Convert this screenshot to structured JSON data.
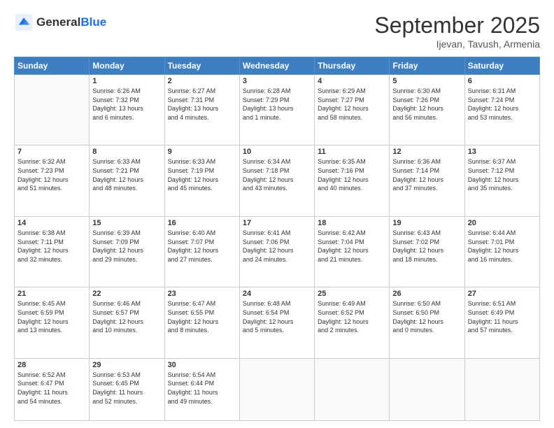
{
  "header": {
    "logo_line1": "General",
    "logo_line2": "Blue",
    "month_title": "September 2025",
    "location": "Ijevan, Tavush, Armenia"
  },
  "weekdays": [
    "Sunday",
    "Monday",
    "Tuesday",
    "Wednesday",
    "Thursday",
    "Friday",
    "Saturday"
  ],
  "weeks": [
    [
      {
        "day": "",
        "info": ""
      },
      {
        "day": "1",
        "info": "Sunrise: 6:26 AM\nSunset: 7:32 PM\nDaylight: 13 hours\nand 6 minutes."
      },
      {
        "day": "2",
        "info": "Sunrise: 6:27 AM\nSunset: 7:31 PM\nDaylight: 13 hours\nand 4 minutes."
      },
      {
        "day": "3",
        "info": "Sunrise: 6:28 AM\nSunset: 7:29 PM\nDaylight: 13 hours\nand 1 minute."
      },
      {
        "day": "4",
        "info": "Sunrise: 6:29 AM\nSunset: 7:27 PM\nDaylight: 12 hours\nand 58 minutes."
      },
      {
        "day": "5",
        "info": "Sunrise: 6:30 AM\nSunset: 7:26 PM\nDaylight: 12 hours\nand 56 minutes."
      },
      {
        "day": "6",
        "info": "Sunrise: 6:31 AM\nSunset: 7:24 PM\nDaylight: 12 hours\nand 53 minutes."
      }
    ],
    [
      {
        "day": "7",
        "info": "Sunrise: 6:32 AM\nSunset: 7:23 PM\nDaylight: 12 hours\nand 51 minutes."
      },
      {
        "day": "8",
        "info": "Sunrise: 6:33 AM\nSunset: 7:21 PM\nDaylight: 12 hours\nand 48 minutes."
      },
      {
        "day": "9",
        "info": "Sunrise: 6:33 AM\nSunset: 7:19 PM\nDaylight: 12 hours\nand 45 minutes."
      },
      {
        "day": "10",
        "info": "Sunrise: 6:34 AM\nSunset: 7:18 PM\nDaylight: 12 hours\nand 43 minutes."
      },
      {
        "day": "11",
        "info": "Sunrise: 6:35 AM\nSunset: 7:16 PM\nDaylight: 12 hours\nand 40 minutes."
      },
      {
        "day": "12",
        "info": "Sunrise: 6:36 AM\nSunset: 7:14 PM\nDaylight: 12 hours\nand 37 minutes."
      },
      {
        "day": "13",
        "info": "Sunrise: 6:37 AM\nSunset: 7:12 PM\nDaylight: 12 hours\nand 35 minutes."
      }
    ],
    [
      {
        "day": "14",
        "info": "Sunrise: 6:38 AM\nSunset: 7:11 PM\nDaylight: 12 hours\nand 32 minutes."
      },
      {
        "day": "15",
        "info": "Sunrise: 6:39 AM\nSunset: 7:09 PM\nDaylight: 12 hours\nand 29 minutes."
      },
      {
        "day": "16",
        "info": "Sunrise: 6:40 AM\nSunset: 7:07 PM\nDaylight: 12 hours\nand 27 minutes."
      },
      {
        "day": "17",
        "info": "Sunrise: 6:41 AM\nSunset: 7:06 PM\nDaylight: 12 hours\nand 24 minutes."
      },
      {
        "day": "18",
        "info": "Sunrise: 6:42 AM\nSunset: 7:04 PM\nDaylight: 12 hours\nand 21 minutes."
      },
      {
        "day": "19",
        "info": "Sunrise: 6:43 AM\nSunset: 7:02 PM\nDaylight: 12 hours\nand 18 minutes."
      },
      {
        "day": "20",
        "info": "Sunrise: 6:44 AM\nSunset: 7:01 PM\nDaylight: 12 hours\nand 16 minutes."
      }
    ],
    [
      {
        "day": "21",
        "info": "Sunrise: 6:45 AM\nSunset: 6:59 PM\nDaylight: 12 hours\nand 13 minutes."
      },
      {
        "day": "22",
        "info": "Sunrise: 6:46 AM\nSunset: 6:57 PM\nDaylight: 12 hours\nand 10 minutes."
      },
      {
        "day": "23",
        "info": "Sunrise: 6:47 AM\nSunset: 6:55 PM\nDaylight: 12 hours\nand 8 minutes."
      },
      {
        "day": "24",
        "info": "Sunrise: 6:48 AM\nSunset: 6:54 PM\nDaylight: 12 hours\nand 5 minutes."
      },
      {
        "day": "25",
        "info": "Sunrise: 6:49 AM\nSunset: 6:52 PM\nDaylight: 12 hours\nand 2 minutes."
      },
      {
        "day": "26",
        "info": "Sunrise: 6:50 AM\nSunset: 6:50 PM\nDaylight: 12 hours\nand 0 minutes."
      },
      {
        "day": "27",
        "info": "Sunrise: 6:51 AM\nSunset: 6:49 PM\nDaylight: 11 hours\nand 57 minutes."
      }
    ],
    [
      {
        "day": "28",
        "info": "Sunrise: 6:52 AM\nSunset: 6:47 PM\nDaylight: 11 hours\nand 54 minutes."
      },
      {
        "day": "29",
        "info": "Sunrise: 6:53 AM\nSunset: 6:45 PM\nDaylight: 11 hours\nand 52 minutes."
      },
      {
        "day": "30",
        "info": "Sunrise: 6:54 AM\nSunset: 6:44 PM\nDaylight: 11 hours\nand 49 minutes."
      },
      {
        "day": "",
        "info": ""
      },
      {
        "day": "",
        "info": ""
      },
      {
        "day": "",
        "info": ""
      },
      {
        "day": "",
        "info": ""
      }
    ]
  ]
}
